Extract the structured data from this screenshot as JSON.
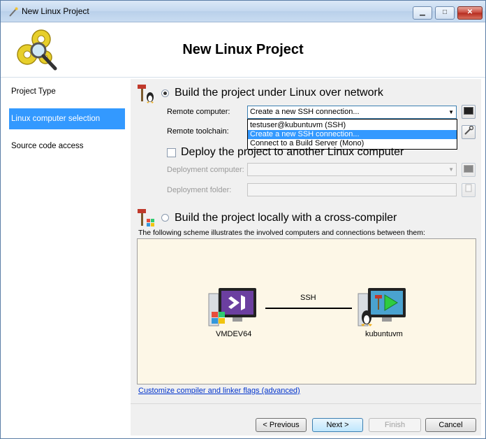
{
  "window": {
    "title": "New Linux Project",
    "minimize_glyph": "▁",
    "maximize_glyph": "□",
    "close_glyph": "✕"
  },
  "header": {
    "title": "New Linux Project",
    "icon": "gears-magnifier-icon"
  },
  "sidebar": {
    "items": [
      {
        "label": "Project Type",
        "active": false
      },
      {
        "label": "Linux computer selection",
        "active": true
      },
      {
        "label": "Source code access",
        "active": false
      }
    ]
  },
  "network": {
    "radio_label": "Build the project under Linux over network",
    "remote_computer_label": "Remote computer:",
    "remote_computer_value": "Create a new SSH connection...",
    "remote_computer_options": [
      "testuser@kubuntuvm (SSH)",
      "Create a new SSH connection...",
      "Connect to a Build Server (Mono)"
    ],
    "selected_option_index": 1,
    "remote_toolchain_label": "Remote toolchain:",
    "deploy_checkbox_label": "Deploy the project to another Linux computer",
    "deployment_computer_label": "Deployment computer:",
    "deployment_folder_label": "Deployment folder:"
  },
  "local": {
    "radio_label": "Build the project locally with a cross-compiler"
  },
  "scheme": {
    "description": "The following scheme illustrates the involved computers and connections between them:",
    "left_machine": "VMDEV64",
    "right_machine": "kubuntuvm",
    "connection": "SSH"
  },
  "link": {
    "label": "Customize compiler and linker flags (advanced)"
  },
  "buttons": {
    "previous": "< Previous",
    "next": "Next >",
    "finish": "Finish",
    "cancel": "Cancel"
  },
  "colors": {
    "selection": "#3399ff",
    "scheme_background": "#fdf7e7",
    "link": "#0033cc"
  }
}
